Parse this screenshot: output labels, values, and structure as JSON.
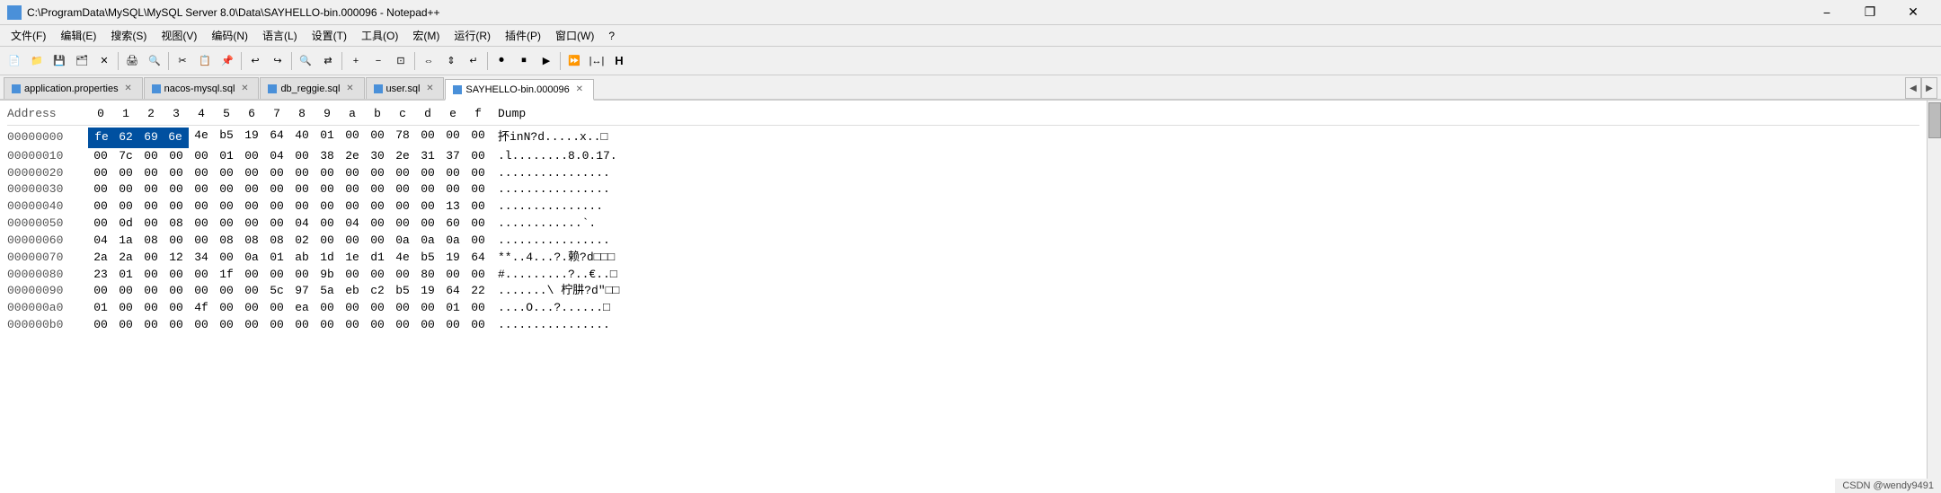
{
  "titlebar": {
    "title": "C:\\ProgramData\\MySQL\\MySQL Server 8.0\\Data\\SAYHELLO-bin.000096 - Notepad++",
    "icon": "notepadpp-icon",
    "minimize_label": "−",
    "restore_label": "❐",
    "close_label": "✕"
  },
  "menubar": {
    "items": [
      {
        "id": "file",
        "label": "文件(F)"
      },
      {
        "id": "edit",
        "label": "编辑(E)"
      },
      {
        "id": "search",
        "label": "搜索(S)"
      },
      {
        "id": "view",
        "label": "视图(V)"
      },
      {
        "id": "encode",
        "label": "编码(N)"
      },
      {
        "id": "language",
        "label": "语言(L)"
      },
      {
        "id": "settings",
        "label": "设置(T)"
      },
      {
        "id": "tools",
        "label": "工具(O)"
      },
      {
        "id": "macro",
        "label": "宏(M)"
      },
      {
        "id": "run",
        "label": "运行(R)"
      },
      {
        "id": "plugins",
        "label": "插件(P)"
      },
      {
        "id": "window",
        "label": "窗口(W)"
      },
      {
        "id": "help",
        "label": "?"
      }
    ]
  },
  "tabs": [
    {
      "id": "application-properties",
      "label": "application.properties",
      "active": false,
      "color": "#4a90d9"
    },
    {
      "id": "nacos-mysql-sql",
      "label": "nacos-mysql.sql",
      "active": false,
      "color": "#4a90d9"
    },
    {
      "id": "db-reggie-sql",
      "label": "db_reggie.sql",
      "active": false,
      "color": "#4a90d9"
    },
    {
      "id": "user-sql",
      "label": "user.sql",
      "active": false,
      "color": "#4a90d9"
    },
    {
      "id": "sayhello-bin",
      "label": "SAYHELLO-bin.000096",
      "active": true,
      "color": "#4a90d9"
    }
  ],
  "hex_header": {
    "address": "Address",
    "cols": [
      "0",
      "1",
      "2",
      "3",
      "4",
      "5",
      "6",
      "7",
      "8",
      "9",
      "a",
      "b",
      "c",
      "d",
      "e",
      "f"
    ],
    "dump": "Dump"
  },
  "hex_rows": [
    {
      "address": "00000000",
      "bytes": [
        "fe",
        "62",
        "69",
        "6e",
        "4e",
        "b5",
        "19",
        "64",
        "40",
        "01",
        "00",
        "00",
        "78",
        "00",
        "00",
        "00"
      ],
      "dump": "抔inN?d.....x..□",
      "selected": [
        0,
        1,
        2,
        3
      ]
    },
    {
      "address": "00000010",
      "bytes": [
        "00",
        "7c",
        "00",
        "00",
        "00",
        "01",
        "00",
        "04",
        "00",
        "38",
        "2e",
        "30",
        "2e",
        "31",
        "37",
        "00"
      ],
      "dump": ".l........8.0.17.",
      "selected": []
    },
    {
      "address": "00000020",
      "bytes": [
        "00",
        "00",
        "00",
        "00",
        "00",
        "00",
        "00",
        "00",
        "00",
        "00",
        "00",
        "00",
        "00",
        "00",
        "00",
        "00"
      ],
      "dump": "................",
      "selected": []
    },
    {
      "address": "00000030",
      "bytes": [
        "00",
        "00",
        "00",
        "00",
        "00",
        "00",
        "00",
        "00",
        "00",
        "00",
        "00",
        "00",
        "00",
        "00",
        "00",
        "00"
      ],
      "dump": "................",
      "selected": []
    },
    {
      "address": "00000040",
      "bytes": [
        "00",
        "00",
        "00",
        "00",
        "00",
        "00",
        "00",
        "00",
        "00",
        "00",
        "00",
        "00",
        "00",
        "00",
        "13",
        "00"
      ],
      "dump": "...............",
      "selected": []
    },
    {
      "address": "00000050",
      "bytes": [
        "00",
        "0d",
        "00",
        "08",
        "00",
        "00",
        "00",
        "00",
        "04",
        "00",
        "04",
        "00",
        "00",
        "00",
        "60",
        "00"
      ],
      "dump": "............`.",
      "selected": []
    },
    {
      "address": "00000060",
      "bytes": [
        "04",
        "1a",
        "08",
        "00",
        "00",
        "08",
        "08",
        "08",
        "02",
        "00",
        "00",
        "00",
        "0a",
        "0a",
        "0a",
        "00"
      ],
      "dump": "................",
      "selected": []
    },
    {
      "address": "00000070",
      "bytes": [
        "2a",
        "2a",
        "00",
        "12",
        "34",
        "00",
        "0a",
        "01",
        "ab",
        "1d",
        "1e",
        "d1",
        "4e",
        "b5",
        "19",
        "64"
      ],
      "dump": "**..4...?.赖?d□□□",
      "selected": []
    },
    {
      "address": "00000080",
      "bytes": [
        "23",
        "01",
        "00",
        "00",
        "00",
        "1f",
        "00",
        "00",
        "00",
        "9b",
        "00",
        "00",
        "00",
        "80",
        "00",
        "00"
      ],
      "dump": "#.........?..€..□",
      "selected": []
    },
    {
      "address": "00000090",
      "bytes": [
        "00",
        "00",
        "00",
        "00",
        "00",
        "00",
        "00",
        "5c",
        "97",
        "5a",
        "eb",
        "c2",
        "b5",
        "19",
        "64",
        "22"
      ],
      "dump": ".......\\ 柠肼?d\"□□",
      "selected": []
    },
    {
      "address": "000000a0",
      "bytes": [
        "01",
        "00",
        "00",
        "00",
        "4f",
        "00",
        "00",
        "00",
        "ea",
        "00",
        "00",
        "00",
        "00",
        "00",
        "01",
        "00"
      ],
      "dump": "....O...?......□",
      "selected": []
    },
    {
      "address": "000000b0",
      "bytes": [
        "00",
        "00",
        "00",
        "00",
        "00",
        "00",
        "00",
        "00",
        "00",
        "00",
        "00",
        "00",
        "00",
        "00",
        "00",
        "00"
      ],
      "dump": "................",
      "selected": []
    }
  ],
  "statusbar": {
    "credit": "CSDN @wendy9491"
  }
}
